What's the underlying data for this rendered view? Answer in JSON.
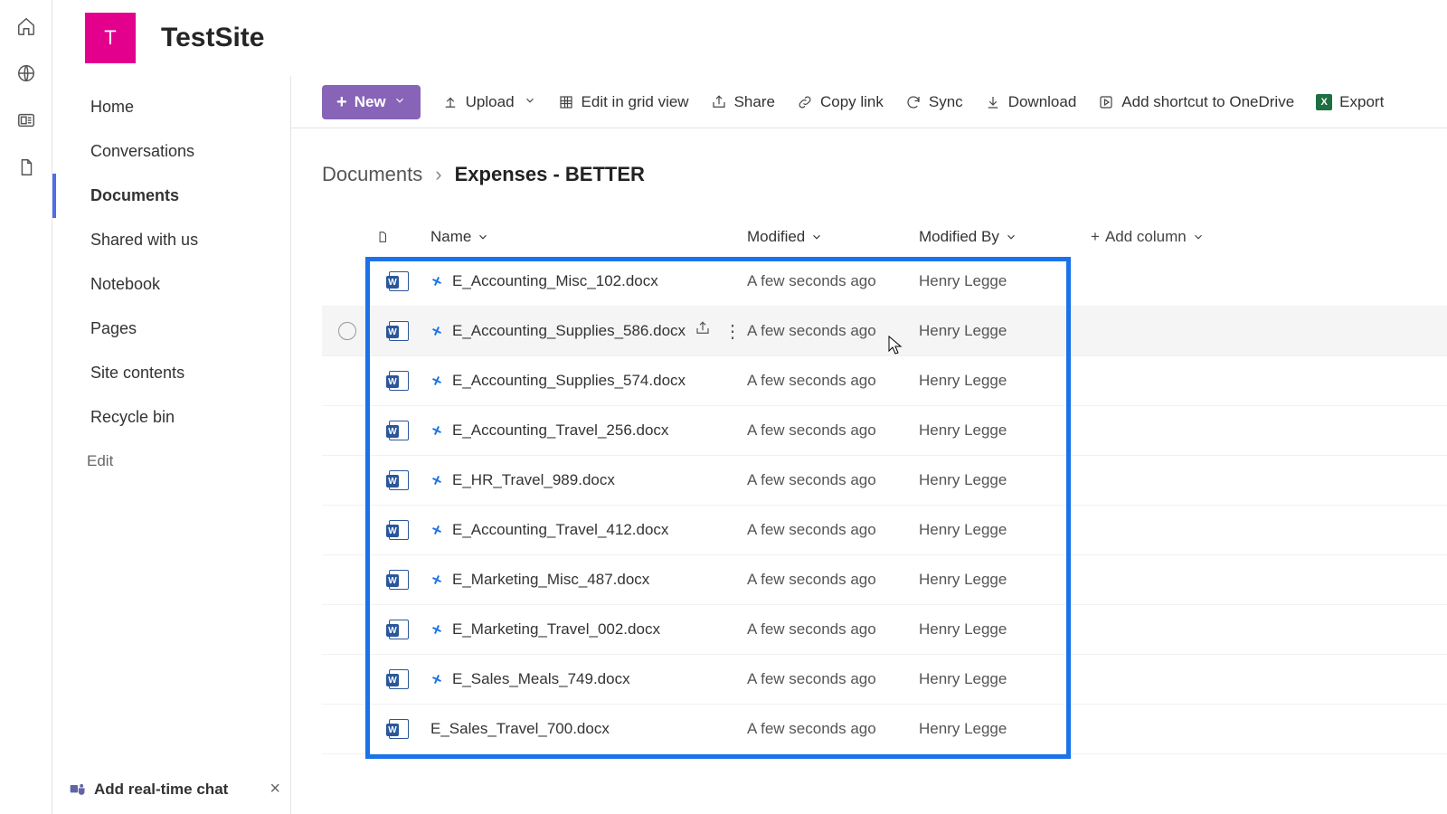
{
  "site": {
    "avatar_letter": "T",
    "title": "TestSite"
  },
  "rail_icons": [
    "home-icon",
    "globe-icon",
    "news-icon",
    "file-icon"
  ],
  "nav": {
    "items": [
      {
        "label": "Home"
      },
      {
        "label": "Conversations"
      },
      {
        "label": "Documents",
        "active": true
      },
      {
        "label": "Shared with us"
      },
      {
        "label": "Notebook"
      },
      {
        "label": "Pages"
      },
      {
        "label": "Site contents"
      },
      {
        "label": "Recycle bin"
      }
    ],
    "edit_label": "Edit"
  },
  "chat_promo": {
    "label": "Add real-time chat"
  },
  "commands": {
    "new": "New",
    "upload": "Upload",
    "edit_grid": "Edit in grid view",
    "share": "Share",
    "copy_link": "Copy link",
    "sync": "Sync",
    "download": "Download",
    "onedrive": "Add shortcut to OneDrive",
    "export": "Export"
  },
  "breadcrumb": {
    "root": "Documents",
    "current": "Expenses - BETTER"
  },
  "columns": {
    "name": "Name",
    "modified": "Modified",
    "modified_by": "Modified By",
    "add": "Add column"
  },
  "files": [
    {
      "name": "E_Accounting_Misc_102.docx",
      "modified": "A few seconds ago",
      "modified_by": "Henry Legge",
      "is_new": true,
      "hovered": false
    },
    {
      "name": "E_Accounting_Supplies_586.docx",
      "modified": "A few seconds ago",
      "modified_by": "Henry Legge",
      "is_new": true,
      "hovered": true
    },
    {
      "name": "E_Accounting_Supplies_574.docx",
      "modified": "A few seconds ago",
      "modified_by": "Henry Legge",
      "is_new": true,
      "hovered": false
    },
    {
      "name": "E_Accounting_Travel_256.docx",
      "modified": "A few seconds ago",
      "modified_by": "Henry Legge",
      "is_new": true,
      "hovered": false
    },
    {
      "name": "E_HR_Travel_989.docx",
      "modified": "A few seconds ago",
      "modified_by": "Henry Legge",
      "is_new": true,
      "hovered": false
    },
    {
      "name": "E_Accounting_Travel_412.docx",
      "modified": "A few seconds ago",
      "modified_by": "Henry Legge",
      "is_new": true,
      "hovered": false
    },
    {
      "name": "E_Marketing_Misc_487.docx",
      "modified": "A few seconds ago",
      "modified_by": "Henry Legge",
      "is_new": true,
      "hovered": false
    },
    {
      "name": "E_Marketing_Travel_002.docx",
      "modified": "A few seconds ago",
      "modified_by": "Henry Legge",
      "is_new": true,
      "hovered": false
    },
    {
      "name": "E_Sales_Meals_749.docx",
      "modified": "A few seconds ago",
      "modified_by": "Henry Legge",
      "is_new": true,
      "hovered": false
    },
    {
      "name": "E_Sales_Travel_700.docx",
      "modified": "A few seconds ago",
      "modified_by": "Henry Legge",
      "is_new": false,
      "hovered": false
    }
  ]
}
